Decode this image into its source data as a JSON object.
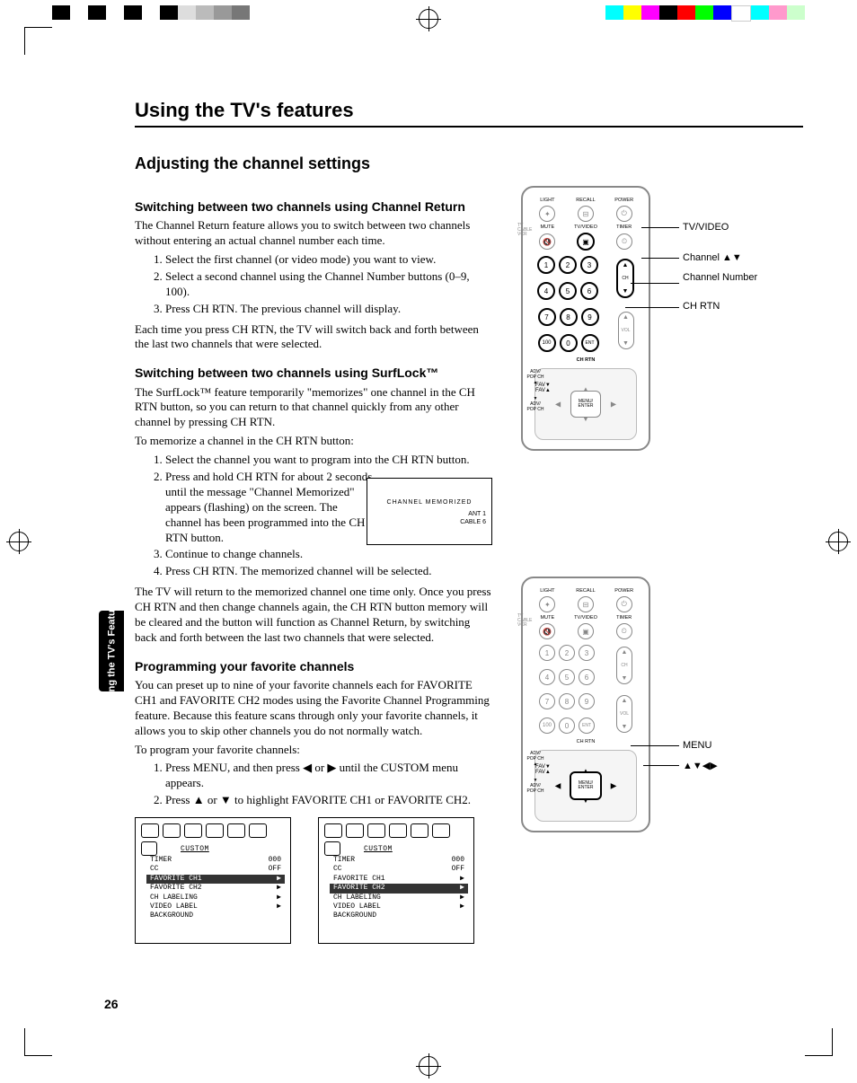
{
  "page_number": "26",
  "sidebar_tab": "Using the TV's Features",
  "h1": "Using the TV's features",
  "h2": "Adjusting the channel settings",
  "sec1": {
    "heading": "Switching between two channels using Channel Return",
    "intro": "The Channel Return feature allows you to switch between two channels without entering an actual channel number each time.",
    "steps": [
      "Select the first channel (or video mode) you want to view.",
      "Select a second channel using the Channel Number buttons (0–9, 100).",
      "Press CH RTN. The previous channel will display."
    ],
    "outro": "Each time you press CH RTN, the TV will switch back and forth between the last two channels that were selected."
  },
  "sec2": {
    "heading": "Switching between two channels using SurfLock™",
    "intro": "The SurfLock™ feature temporarily \"memorizes\" one channel in the CH RTN button, so you can return to that channel quickly from any other channel by pressing CH RTN.",
    "lead": "To memorize a channel in the CH RTN button:",
    "steps": [
      "Select the channel you want to program into the CH RTN button.",
      "Press and hold CH RTN for about 2 seconds until the message \"Channel Memorized\" appears (flashing) on the screen. The channel has been programmed into the CH RTN button.",
      "Continue to change channels.",
      "Press CH RTN. The memorized channel will be selected."
    ],
    "outro": "The TV will return to the memorized channel one time only. Once you press CH RTN and then change channels again, the CH RTN button memory will be cleared and the button will function as Channel Return, by switching back and forth between the last two channels that were selected."
  },
  "sec3": {
    "heading": "Programming your favorite channels",
    "intro": "You can preset up to nine of your favorite channels each for FAVORITE CH1 and FAVORITE CH2 modes using the Favorite Channel Programming feature. Because this feature scans through only your favorite channels, it allows you to skip other channels you do not normally watch.",
    "lead": "To program your favorite channels:",
    "steps": [
      "Press MENU, and then press ◀ or ▶ until the CUSTOM menu appears.",
      "Press ▲ or ▼ to highlight FAVORITE CH1 or FAVORITE CH2."
    ]
  },
  "osd_memorized": {
    "line1": "CHANNEL  MEMORIZED",
    "ant": "ANT  1",
    "cable": "CABLE     6"
  },
  "remote_callouts_1": {
    "a": "TV/VIDEO",
    "b": "Channel ▲▼",
    "c": "Channel Number",
    "d": "CH RTN"
  },
  "remote_callouts_2": {
    "a": "MENU",
    "b": "▲▼◀▶"
  },
  "remote_labels": {
    "row1": [
      "LIGHT",
      "RECALL",
      "POWER"
    ],
    "row2": [
      "MUTE",
      "TV/VIDEO",
      "TIMER"
    ],
    "side": "TV\nCABLE\nVCR",
    "chrtn": "CH RTN",
    "vol": "VOL",
    "ch": "CH",
    "ent": "ENT",
    "hundred": "100",
    "menu": "MENU/\nENTER",
    "fav_l": "FAV▼",
    "fav_r": "FAV▲",
    "adv_up": "ADV/\nPOP CH",
    "adv_dn": "ADV/\nPOP CH"
  },
  "custom_menu": {
    "title": "CUSTOM",
    "items": [
      {
        "label": "TIMER",
        "val": "000"
      },
      {
        "label": "CC",
        "val": "OFF"
      },
      {
        "label": "FAVORITE CH1",
        "val": "▶"
      },
      {
        "label": "FAVORITE CH2",
        "val": "▶"
      },
      {
        "label": "CH LABELING",
        "val": "▶"
      },
      {
        "label": "VIDEO LABEL",
        "val": "▶"
      },
      {
        "label": "BACKGROUND",
        "val": ""
      }
    ],
    "highlight1": 2,
    "highlight2": 3
  }
}
